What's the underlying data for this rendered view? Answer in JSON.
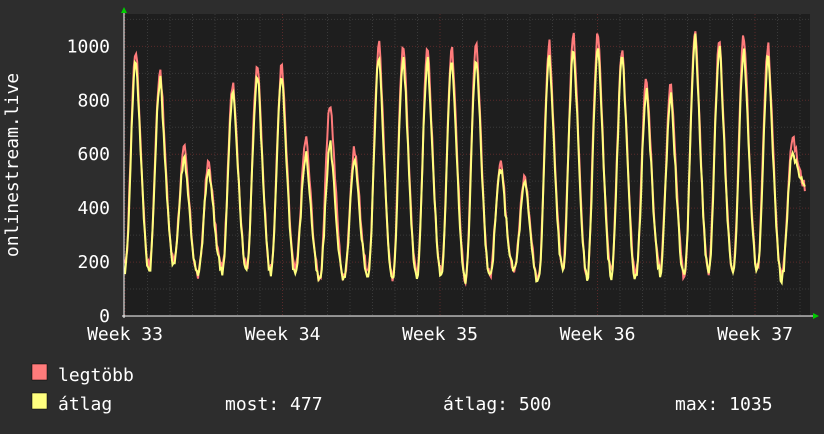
{
  "chart_data": {
    "type": "line",
    "ylabel": "onlinestream.live",
    "y_ticks": [
      "0",
      "200",
      "400",
      "600",
      "800",
      "1000"
    ],
    "x_ticks": [
      "Week 33",
      "Week 34",
      "Week 35",
      "Week 36",
      "Week 37"
    ],
    "ylim": [
      0,
      1120
    ],
    "grid": true,
    "colors": {
      "background": "#2d2d2d",
      "plot_bg": "#1e1e1e",
      "grid_major": "#5a2a2a",
      "grid_minor": "#3a3a3a",
      "axis": "#ffffff",
      "arrow": "#00cc00"
    },
    "series": [
      {
        "name": "legtöbb",
        "color": "#ff7b7b",
        "daily_peaks": [
          990,
          920,
          620,
          570,
          870,
          930,
          930,
          660,
          790,
          620,
          1010,
          1010,
          990,
          1000,
          1000,
          580,
          520,
          1010,
          1040,
          1050,
          1000,
          880,
          860,
          1070,
          1030,
          1040,
          1010,
          660
        ],
        "daily_troughs": [
          180,
          210,
          150,
          180,
          180,
          170,
          170,
          140,
          140,
          160,
          140,
          160,
          160,
          140,
          150,
          180,
          140,
          180,
          150,
          160,
          150,
          170,
          150,
          170,
          160,
          180,
          150,
          480
        ]
      },
      {
        "name": "átlag",
        "color": "#ffff7f",
        "daily_peaks": [
          950,
          880,
          590,
          540,
          830,
          900,
          890,
          600,
          640,
          570,
          970,
          960,
          950,
          950,
          960,
          550,
          490,
          960,
          990,
          1000,
          960,
          830,
          820,
          1035,
          990,
          990,
          960,
          600
        ],
        "daily_troughs": [
          170,
          200,
          150,
          170,
          170,
          160,
          160,
          130,
          130,
          150,
          130,
          150,
          150,
          130,
          140,
          170,
          130,
          170,
          140,
          150,
          140,
          160,
          140,
          160,
          150,
          170,
          140,
          477
        ]
      }
    ]
  },
  "legend": {
    "items": [
      {
        "label": "legtöbb",
        "color": "#ff7b7b"
      },
      {
        "label": "átlag",
        "color": "#ffff7f"
      }
    ],
    "stats": {
      "now": "most: 477",
      "avg": "átlag: 500",
      "max": "max: 1035"
    }
  }
}
